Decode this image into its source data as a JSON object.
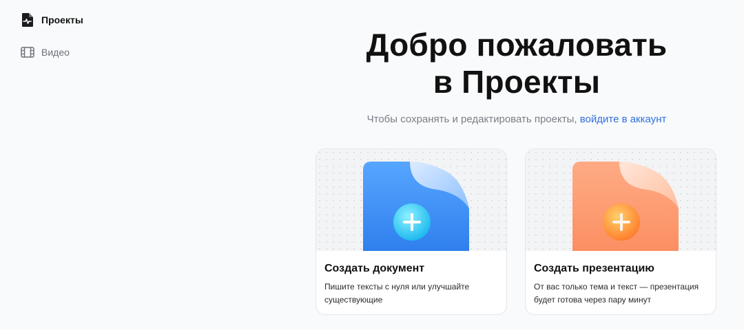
{
  "sidebar": {
    "items": [
      {
        "label": "Проекты",
        "icon": "document-spark-icon",
        "active": true
      },
      {
        "label": "Видео",
        "icon": "film-icon",
        "active": false
      }
    ]
  },
  "main": {
    "title_line1": "Добро пожаловать",
    "title_line2": "в Проекты",
    "subtitle_text": "Чтобы сохранять и редактировать проекты,",
    "login_link": "войдите в аккаунт"
  },
  "cards": [
    {
      "title": "Создать документ",
      "description": "Пишите тексты с нуля или улучшайте существующие",
      "icon": "blue-document-plus-icon",
      "accent": "#3d8cf2"
    },
    {
      "title": "Создать презентацию",
      "description": "От вас только тема и текст — презентация будет готова через пару минут",
      "icon": "orange-document-plus-icon",
      "accent": "#fb8f62"
    }
  ],
  "colors": {
    "link": "#2f6fdb",
    "background": "#f9fafc"
  }
}
